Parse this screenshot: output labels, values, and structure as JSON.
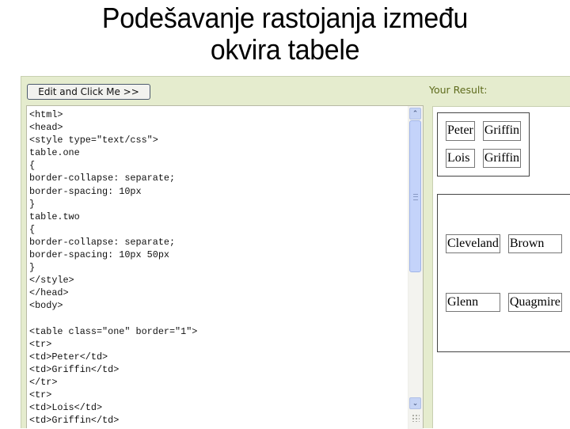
{
  "slide": {
    "title_line1": "Podešavanje rastojanja između",
    "title_line2": "okvira tabele"
  },
  "editor": {
    "button_label": "Edit and Click Me >>",
    "code": "<html>\n<head>\n<style type=\"text/css\">\ntable.one\n{\nborder-collapse: separate;\nborder-spacing: 10px\n}\ntable.two\n{\nborder-collapse: separate;\nborder-spacing: 10px 50px\n}\n</style>\n</head>\n<body>\n\n<table class=\"one\" border=\"1\">\n<tr>\n<td>Peter</td>\n<td>Griffin</td>\n</tr>\n<tr>\n<td>Lois</td>\n<td>Griffin</td>",
    "scrollbar": {
      "up_icon": "▲",
      "down_icon": "▼"
    }
  },
  "result": {
    "label": "Your Result:",
    "table_one": [
      [
        "Peter",
        "Griffin"
      ],
      [
        "Lois",
        "Griffin"
      ]
    ],
    "table_two": [
      [
        "Cleveland",
        "Brown"
      ],
      [
        "Glenn",
        "Quagmire"
      ]
    ]
  }
}
